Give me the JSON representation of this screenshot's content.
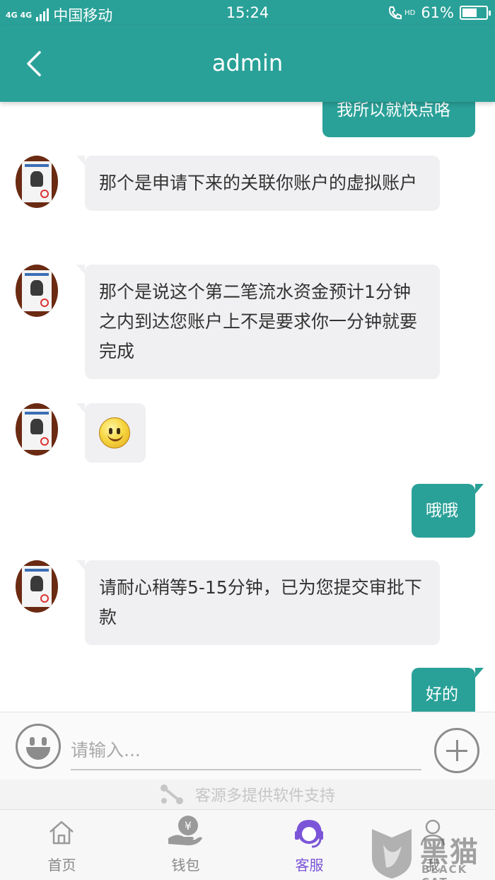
{
  "status_bar": {
    "network": "4G 4G",
    "carrier": "中国移动",
    "time": "15:24",
    "hd_label": "HD",
    "battery": "61%",
    "battery_level": 0.61
  },
  "header": {
    "title": "admin"
  },
  "messages": [
    {
      "from": "self",
      "text": "我所以就快点咯"
    },
    {
      "from": "agent",
      "text": "那个是申请下来的关联你账户的虚拟账户"
    },
    {
      "from": "agent",
      "text": "那个是说这个第二笔流水资金预计1分钟之内到达您账户上不是要求你一分钟就要完成"
    },
    {
      "from": "agent",
      "text": "",
      "emoji": "smile"
    },
    {
      "from": "self",
      "text": "哦哦"
    },
    {
      "from": "agent",
      "text": "请耐心稍等5-15分钟，已为您提交审批下款"
    },
    {
      "from": "self",
      "text": "好的"
    }
  ],
  "input": {
    "placeholder": "请输入..."
  },
  "support_text": "客源多提供软件支持",
  "tabs": [
    {
      "label": "首页",
      "icon": "home-icon"
    },
    {
      "label": "钱包",
      "icon": "wallet-icon"
    },
    {
      "label": "客服",
      "icon": "customer-service-icon",
      "active": true
    },
    {
      "label": "我",
      "icon": "profile-icon"
    }
  ],
  "watermark": {
    "text": "黑猫",
    "sub": "BLACK CAT"
  },
  "colors": {
    "accent": "#2aa198",
    "active_tab": "#7b55d8"
  }
}
